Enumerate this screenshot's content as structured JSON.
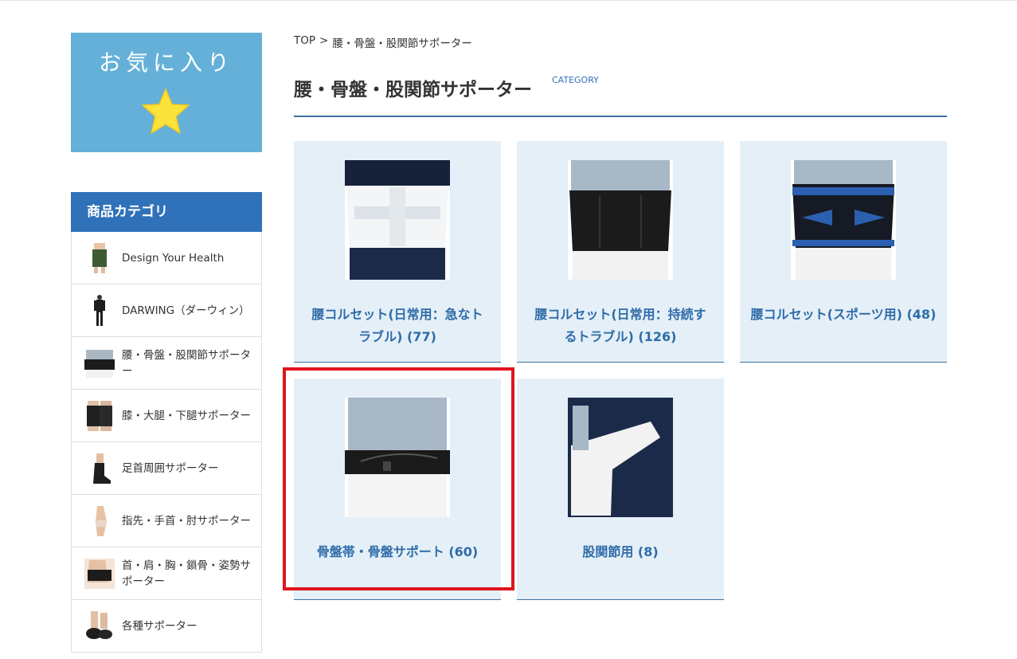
{
  "favorites": {
    "label": "お気に入り"
  },
  "sidebar": {
    "header": "商品カテゴリ",
    "items": [
      {
        "label": "Design Your Health"
      },
      {
        "label": "DARWING（ダーウィン）"
      },
      {
        "label": "腰・骨盤・股関節サポーター"
      },
      {
        "label": "膝・大腿・下腿サポーター"
      },
      {
        "label": "足首周囲サポーター"
      },
      {
        "label": "指先・手首・肘サポーター"
      },
      {
        "label": "首・肩・胸・鎖骨・姿勢サポーター"
      },
      {
        "label": "各種サポーター"
      }
    ]
  },
  "breadcrumb": {
    "top": "TOP",
    "separator": ">",
    "current": "腰・骨盤・股関節サポーター"
  },
  "page": {
    "title": "腰・骨盤・股関節サポーター",
    "tag": "CATEGORY"
  },
  "cards": [
    {
      "line1": "腰コルセット(日常用：急なト",
      "line2": "ラブル) (77)"
    },
    {
      "line1": "腰コルセット(日常用：持続す",
      "line2": "るトラブル) (126)"
    },
    {
      "line1": "腰コルセット(スポーツ用) (48)",
      "line2": ""
    },
    {
      "line1": "骨盤帯・骨盤サポート (60)",
      "line2": ""
    },
    {
      "line1": "股関節用 (8)",
      "line2": ""
    }
  ],
  "colors": {
    "accent": "#3072b9",
    "favorites_bg": "#64b0d8",
    "card_bg": "#e4eff7",
    "highlight": "#e0141e"
  }
}
